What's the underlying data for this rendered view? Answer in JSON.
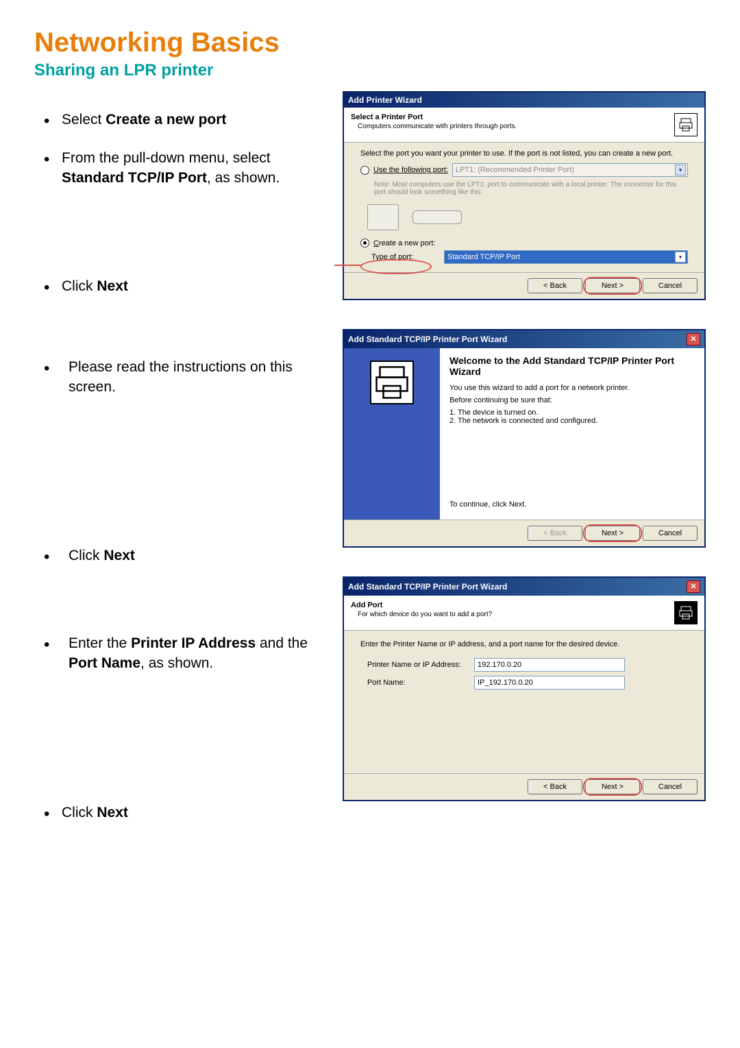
{
  "page": {
    "title": "Networking Basics",
    "subtitle": "Sharing an LPR printer"
  },
  "instructions": {
    "i1a": "Select ",
    "i1b": "Create a new port",
    "i2a": "From the pull-down menu, select ",
    "i2b": "Standard TCP/IP Port",
    "i2c": ", as shown.",
    "i3a": "Click ",
    "i3b": "Next",
    "i4": "Please read the instructions on this screen.",
    "i5a": "Click ",
    "i5b": "Next",
    "i6a": "Enter the ",
    "i6b": "Printer IP Address",
    "i6c": " and the ",
    "i6d": "Port Name",
    "i6e": ", as shown.",
    "i7a": "Click ",
    "i7b": "Next"
  },
  "d1": {
    "title": "Add Printer Wizard",
    "hdr_title": "Select a Printer Port",
    "hdr_sub": "Computers communicate with printers through ports.",
    "body1": "Select the port you want your printer to use.  If the port is not listed, you can create a new port.",
    "opt1": "Use the following port:",
    "opt1_val": "LPT1: (Recommended Printer Port)",
    "note1": "Note: Most computers use the LPT1: port to communicate with a local printer. The connector for this port should look something like this:",
    "opt2": "Create a new port:",
    "type_label": "Type of port:",
    "type_val": "Standard TCP/IP Port",
    "back": "< Back",
    "next": "Next >",
    "cancel": "Cancel"
  },
  "d2": {
    "title": "Add Standard TCP/IP Printer Port Wizard",
    "welcome_title": "Welcome to the Add Standard TCP/IP Printer Port Wizard",
    "p1": "You use this wizard to add a port for a network printer.",
    "p2": "Before continuing be sure that:",
    "p2a": "1.  The device is turned on.",
    "p2b": "2.  The network is connected and configured.",
    "p3": "To continue, click Next.",
    "back": "< Back",
    "next": "Next >",
    "cancel": "Cancel"
  },
  "d3": {
    "title": "Add Standard TCP/IP Printer Port Wizard",
    "hdr_title": "Add Port",
    "hdr_sub": "For which device do you want to add a port?",
    "body1": "Enter the Printer Name or IP address, and a port name for the desired device.",
    "f1_label": "Printer Name or IP Address:",
    "f1_value": "192.170.0.20",
    "f2_label": "Port Name:",
    "f2_value": "IP_192.170.0.20",
    "back": "< Back",
    "next": "Next >",
    "cancel": "Cancel"
  }
}
